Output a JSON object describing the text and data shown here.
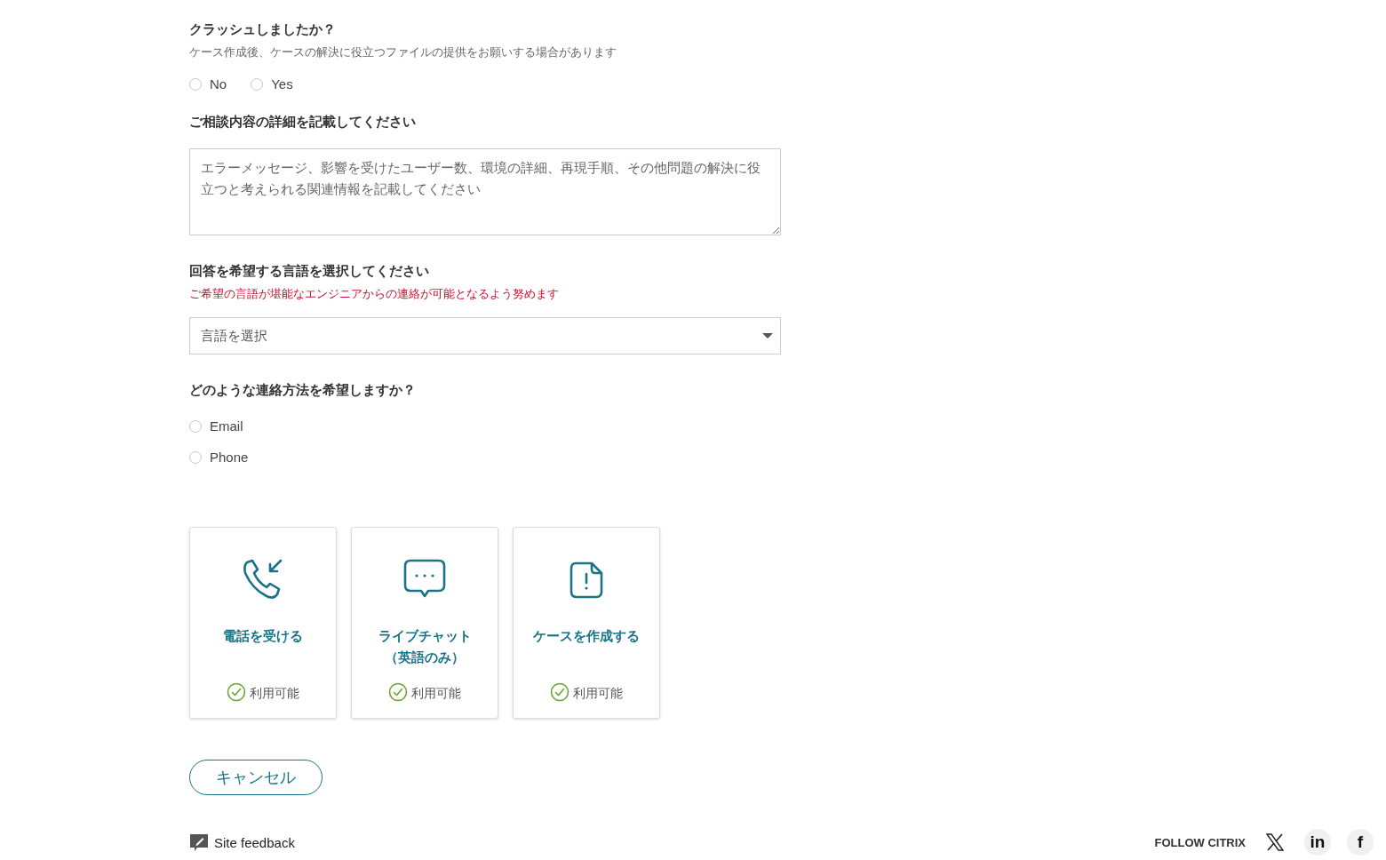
{
  "crash_question": {
    "title": "クラッシュしましたか？",
    "hint": "ケース作成後、ケースの解決に役立つファイルの提供をお願いする場合があります",
    "options": [
      {
        "label": "No",
        "selected": false
      },
      {
        "label": "Yes",
        "selected": false
      }
    ]
  },
  "details": {
    "title": "ご相談内容の詳細を記載してください",
    "placeholder": "エラーメッセージ、影響を受けたユーザー数、環境の詳細、再現手順、その他問題の解決に役立つと考えられる関連情報を記載してください"
  },
  "language": {
    "title": "回答を希望する言語を選択してください",
    "note": "ご希望の言語が堪能なエンジニアからの連絡が可能となるよう努めます",
    "placeholder": "言語を選択"
  },
  "contact_method": {
    "title": "どのような連絡方法を希望しますか？",
    "options": [
      {
        "label": "Email",
        "selected": false
      },
      {
        "label": "Phone",
        "selected": false
      }
    ]
  },
  "channels": [
    {
      "kind": "phone",
      "title": "電話を受ける",
      "status": "利用可能",
      "available": true
    },
    {
      "kind": "chat",
      "title": "ライブチャット（英語のみ）",
      "status": "利用可能",
      "available": true
    },
    {
      "kind": "case",
      "title": "ケースを作成する",
      "status": "利用可能",
      "available": true
    }
  ],
  "cancel_button": "キャンセル",
  "footer": {
    "feedback": "Site feedback",
    "follow": "FOLLOW CITRIX",
    "social": [
      {
        "kind": "x"
      },
      {
        "kind": "linkedin",
        "label": "in"
      },
      {
        "kind": "facebook",
        "label": "f"
      }
    ]
  }
}
